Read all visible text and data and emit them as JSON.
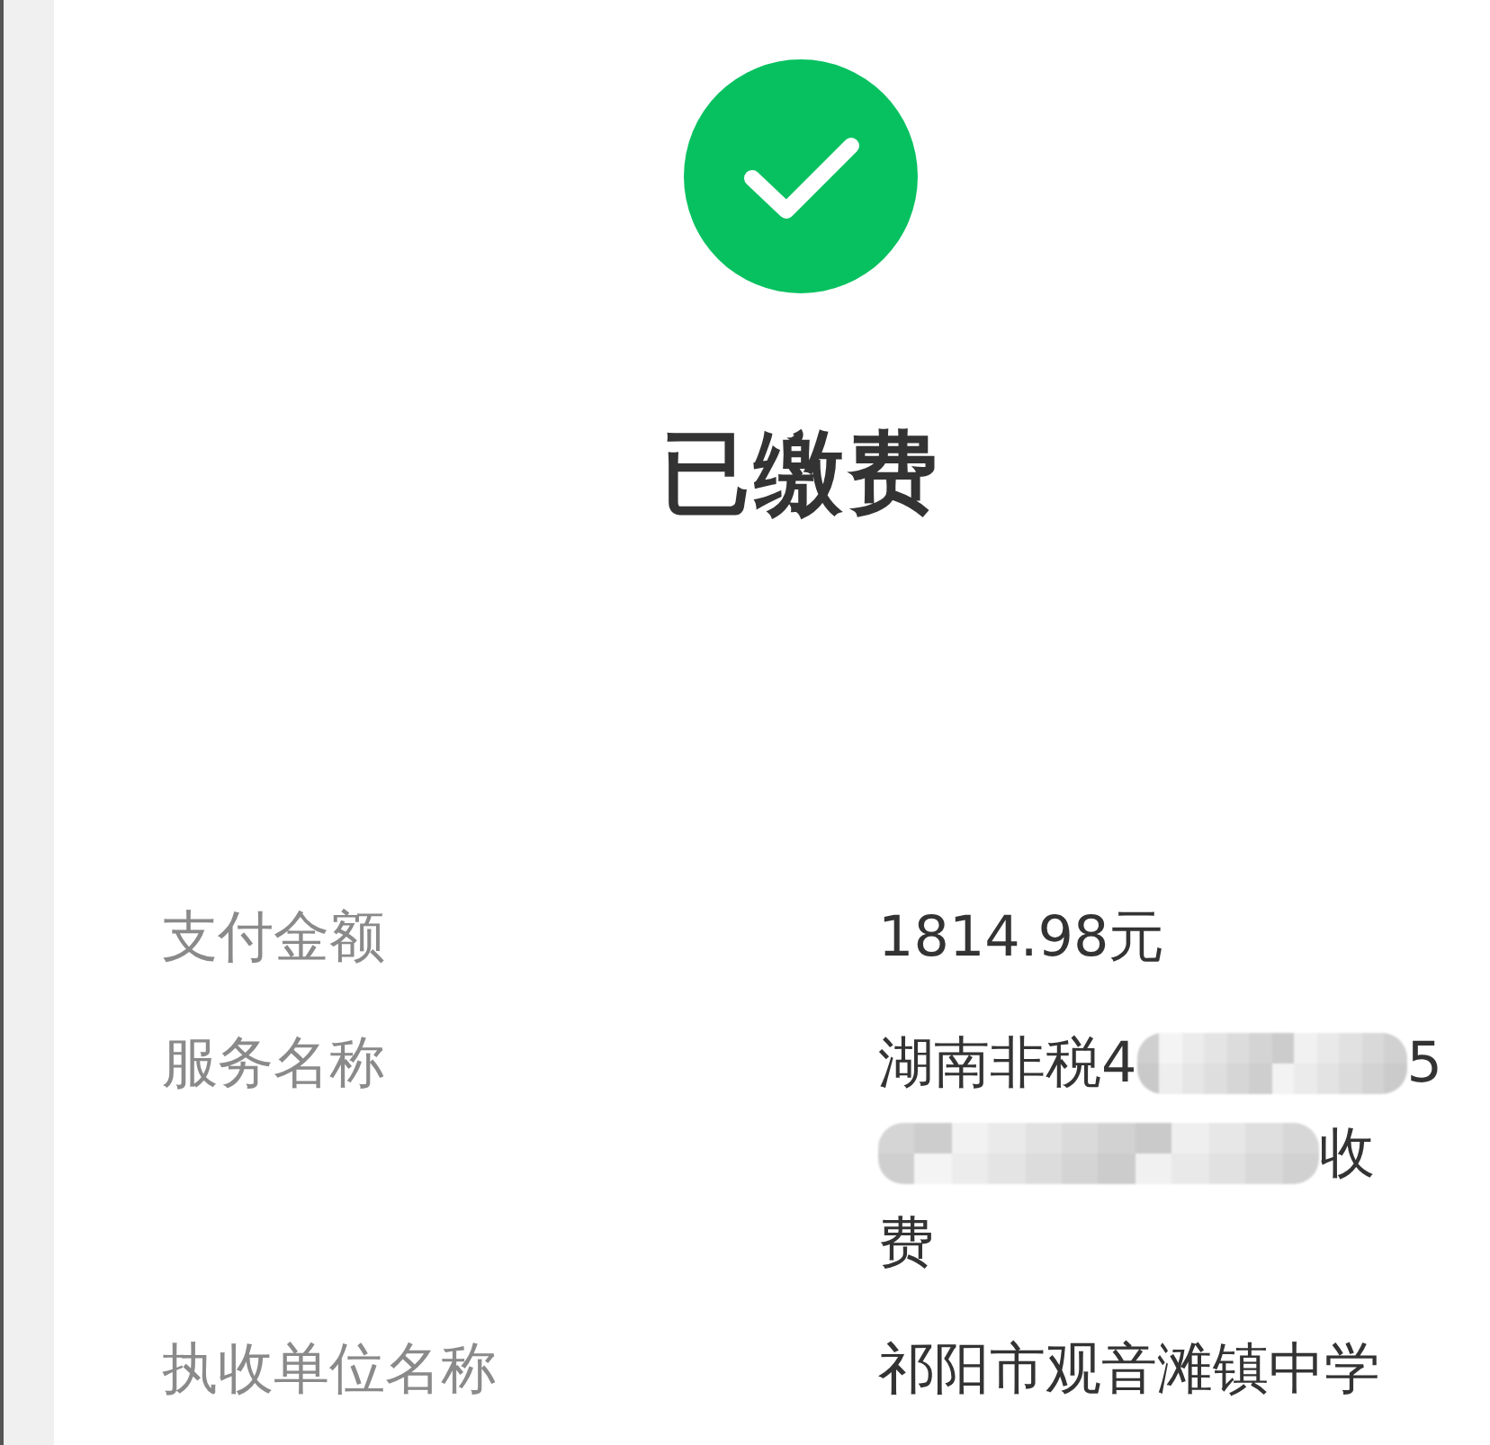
{
  "status": {
    "title": "已缴费"
  },
  "details": [
    {
      "label": "支付金额",
      "lines": [
        [
          {
            "kind": "text",
            "text": "1814.98元"
          }
        ]
      ]
    },
    {
      "label": "服务名称",
      "lines": [
        [
          {
            "kind": "text",
            "text": "湖南非税4"
          },
          {
            "kind": "redacted"
          },
          {
            "kind": "text",
            "text": "5"
          }
        ],
        [
          {
            "kind": "redacted"
          },
          {
            "kind": "text",
            "text": "收"
          }
        ],
        [
          {
            "kind": "text",
            "text": "费"
          }
        ]
      ]
    },
    {
      "label": "执收单位名称",
      "lines": [
        [
          {
            "kind": "text",
            "text": "祁阳市观音滩镇中学"
          }
        ]
      ]
    }
  ]
}
